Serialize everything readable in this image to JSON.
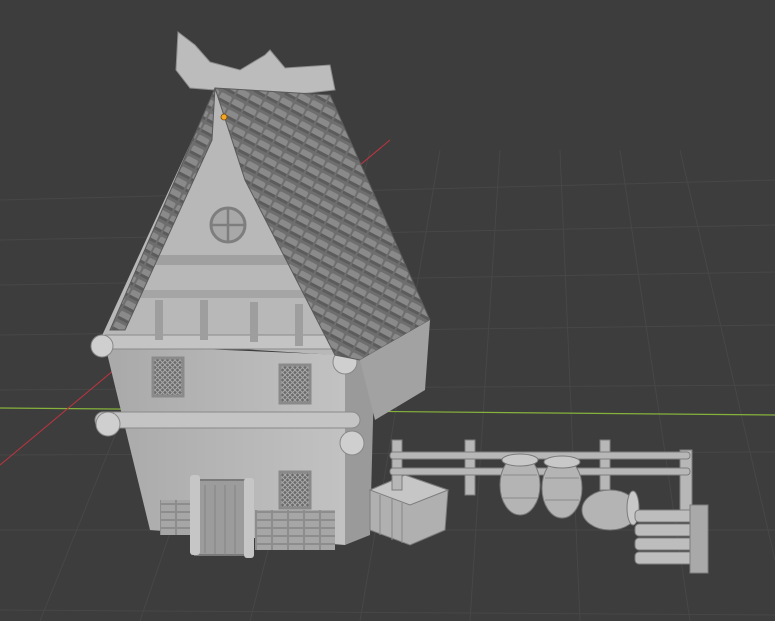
{
  "viewport": {
    "background": "#3d3d3d",
    "grid_color": "#4a4a4a",
    "x_axis_color": "#86b23c",
    "y_axis_color": "#c0343f",
    "origin_color": "#f5a623",
    "model_color": "#b5b5b5",
    "model_shadow": "#8e8e8e",
    "roof_color": "#6b6b6b"
  },
  "scene": {
    "objects": [
      "house",
      "roof",
      "fence",
      "barrels",
      "crate",
      "stacked-planks"
    ],
    "icons": [
      "origin-point-icon"
    ]
  }
}
